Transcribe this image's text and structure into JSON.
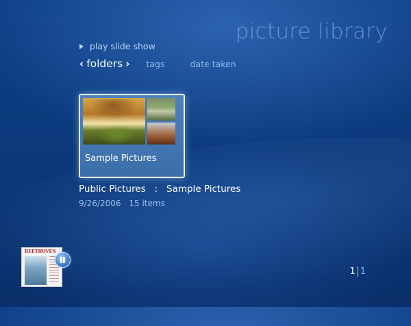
{
  "header": {
    "title": "picture library"
  },
  "actions": {
    "slideshow_label": "play slide show"
  },
  "tabs": {
    "active": "folders",
    "items": [
      {
        "label": "tags"
      },
      {
        "label": "date taken"
      }
    ]
  },
  "gallery": {
    "tile_label": "Sample Pictures"
  },
  "details": {
    "breadcrumb": "Public Pictures   :   Sample Pictures",
    "date": "9/26/2006",
    "count": "15 items"
  },
  "now_playing": {
    "album_title": "BEETHOVEN"
  },
  "pager": {
    "current": "1",
    "total": "1"
  },
  "colors": {
    "accent": "#0c3a7d",
    "link": "#8fb9ef"
  },
  "icons": {
    "play": "play-triangle-icon",
    "pause": "pause-icon"
  }
}
